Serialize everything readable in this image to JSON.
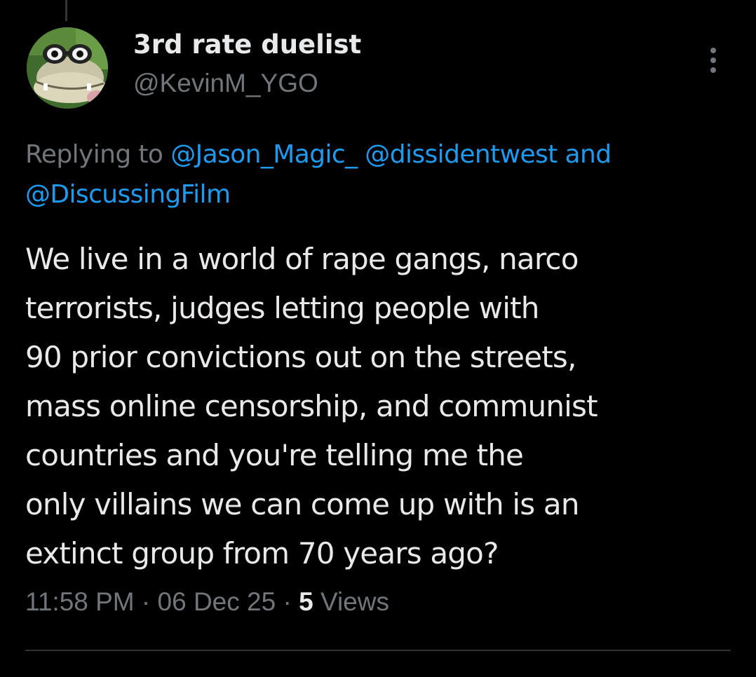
{
  "tweet": {
    "display_name": "3rd rate duelist",
    "handle": "@KevinM_YGO",
    "avatar_icon": "avatar-image",
    "more_icon": "more-options-icon",
    "reply": {
      "prefix": "Replying to",
      "mention_1": "@Jason_Magic_",
      "mention_2": "@dissidentwest",
      "conjunction": "and",
      "mention_3": "@DiscussingFilm"
    },
    "text_lines": [
      "We live in a world of rape gangs, narco",
      "terrorists, judges letting people with",
      "90 prior convictions out on the streets,",
      "mass online censorship, and communist",
      "countries and you're telling me the",
      "only villains we can come up with is an",
      "extinct group from 70 years ago?"
    ],
    "time": "11:58 PM",
    "separator": "·",
    "date": "06 Dec 25",
    "views_count": "5",
    "views_label": "Views"
  },
  "colors": {
    "background": "#000000",
    "text_primary": "#e7e9ea",
    "text_secondary": "#71767b",
    "mention": "#1d9bf0",
    "divider": "#2f3336"
  }
}
